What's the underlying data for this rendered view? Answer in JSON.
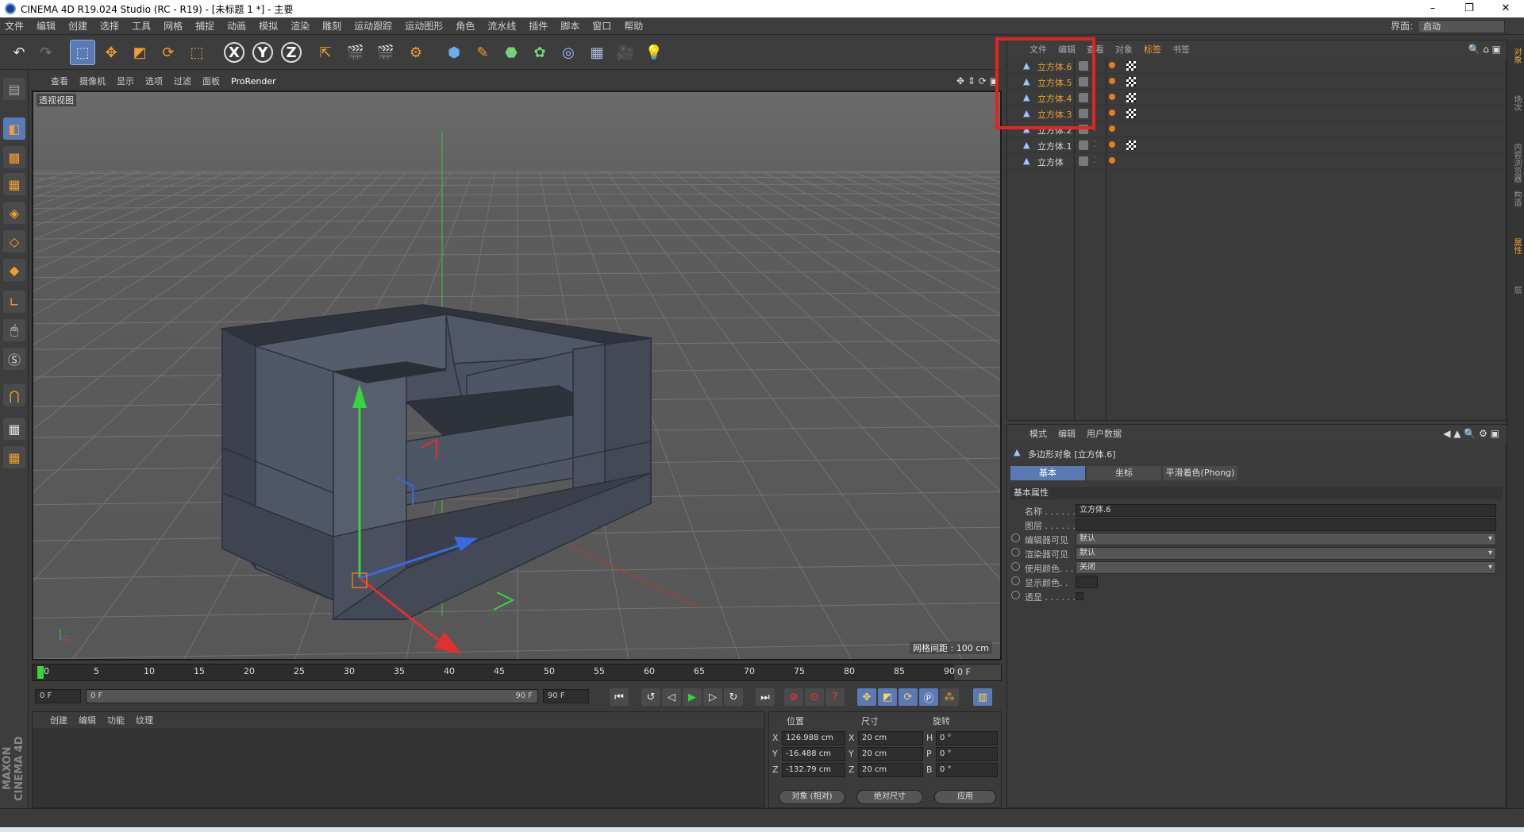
{
  "window": {
    "title": "CINEMA 4D R19.024 Studio (RC - R19) - [未标题 1 *] - 主要",
    "minimize": "–",
    "maximize": "❐",
    "close": "✕"
  },
  "menubar": [
    "文件",
    "编辑",
    "创建",
    "选择",
    "工具",
    "网格",
    "捕捉",
    "动画",
    "模拟",
    "渲染",
    "雕刻",
    "运动跟踪",
    "运动图形",
    "角色",
    "流水线",
    "插件",
    "脚本",
    "窗口",
    "帮助"
  ],
  "layout": {
    "label": "界面:",
    "value": "启动"
  },
  "toolbar": {
    "undo_icon": "undo-icon",
    "x_label": "X",
    "y_label": "Y",
    "z_label": "Z"
  },
  "viewport": {
    "menu": [
      "查看",
      "摄像机",
      "显示",
      "选项",
      "过滤",
      "面板",
      "ProRender"
    ],
    "label": "透视视图",
    "grid_spacing": "网格间距 : 100 cm"
  },
  "timeline": {
    "ticks": [
      "0",
      "5",
      "10",
      "15",
      "20",
      "25",
      "30",
      "35",
      "40",
      "45",
      "50",
      "55",
      "60",
      "65",
      "70",
      "75",
      "80",
      "85",
      "90"
    ],
    "current_frame": "0 F"
  },
  "playback": {
    "start": "0 F",
    "range_start": "0 F",
    "range_end": "90 F",
    "end": "90 F"
  },
  "materials": {
    "menu": [
      "创建",
      "编辑",
      "功能",
      "纹理"
    ]
  },
  "coords": {
    "headers": [
      "位置",
      "尺寸",
      "旋转"
    ],
    "rows": [
      {
        "axis": "X",
        "pos": "126.988 cm",
        "size_axis": "X",
        "size": "20 cm",
        "rot_axis": "H",
        "rot": "0 °"
      },
      {
        "axis": "Y",
        "pos": "-16.488 cm",
        "size_axis": "Y",
        "size": "20 cm",
        "rot_axis": "P",
        "rot": "0 °"
      },
      {
        "axis": "Z",
        "pos": "-132.79 cm",
        "size_axis": "Z",
        "size": "20 cm",
        "rot_axis": "B",
        "rot": "0 °"
      }
    ],
    "mode": "对象 (相对)",
    "size_mode": "绝对尺寸",
    "apply": "应用"
  },
  "brand": "MAXON CINEMA 4D",
  "object_manager": {
    "menu": [
      "文件",
      "编辑",
      "查看",
      "对象",
      "标签",
      "书签"
    ],
    "active_menu": "标签",
    "objects": [
      {
        "name": "立方体.6",
        "selected": true,
        "checker": true
      },
      {
        "name": "立方体.5",
        "selected": true,
        "checker": true
      },
      {
        "name": "立方体.4",
        "selected": true,
        "checker": true
      },
      {
        "name": "立方体.3",
        "selected": true,
        "checker": true
      },
      {
        "name": "立方体.2",
        "selected": false,
        "checker": false
      },
      {
        "name": "立方体.1",
        "selected": false,
        "checker": true
      },
      {
        "name": "立方体",
        "selected": false,
        "checker": false
      }
    ]
  },
  "attribute_manager": {
    "menu": [
      "模式",
      "编辑",
      "用户数据"
    ],
    "object_title": "多边形对象 [立方体.6]",
    "tabs": [
      "基本",
      "坐标",
      "平滑着色(Phong)"
    ],
    "section": "基本属性",
    "fields": [
      {
        "label": "名称 . . . . . .",
        "value": "立方体.6",
        "type": "text"
      },
      {
        "label": "图层 . . . . . .",
        "value": "",
        "type": "text"
      },
      {
        "label": "编辑器可见",
        "value": "默认",
        "type": "select"
      },
      {
        "label": "渲染器可见",
        "value": "默认",
        "type": "select"
      },
      {
        "label": "使用颜色. . . .",
        "value": "关闭",
        "type": "select"
      },
      {
        "label": "显示颜色. .",
        "value": "",
        "type": "color"
      },
      {
        "label": "透显 . . . . . .",
        "value": "",
        "type": "check"
      }
    ]
  },
  "right_tabs": [
    "对象",
    "场次",
    "内容浏览器",
    "构造",
    "属性",
    "层"
  ]
}
